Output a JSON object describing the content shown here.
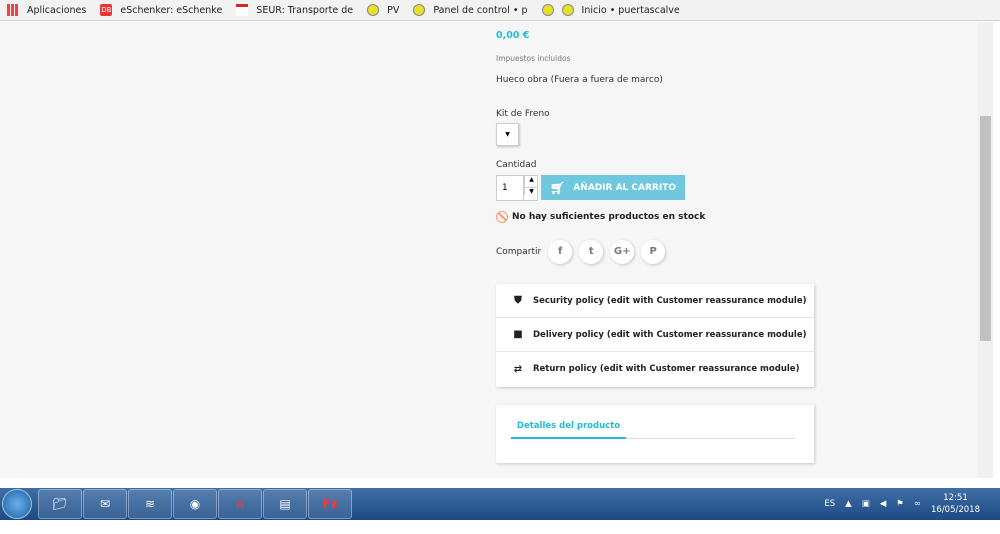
{
  "bookmarks": [
    {
      "label": "Aplicaciones",
      "icon": "apps-grid-icon"
    },
    {
      "label": "eSchenker: eSchenke",
      "icon": "db-icon"
    },
    {
      "label": "SEUR: Transporte de",
      "icon": "seur-icon"
    },
    {
      "label": "PV",
      "icon": "site-icon"
    },
    {
      "label": "Panel de control • p",
      "icon": "site-icon"
    },
    {
      "label": "",
      "icon": "site-icon"
    },
    {
      "label": "Inicio • puertascalve",
      "icon": "site-icon"
    }
  ],
  "product": {
    "price": "0,00 €",
    "tax_label": "Impuestos incluidos",
    "dimension": "Hueco obra (Fuera a fuera de marco)",
    "kit_label": "Kit de Freno",
    "qty_label": "Cantidad",
    "qty_value": "1",
    "add_to_cart": "AÑADIR AL CARRITO",
    "stock_msg": "No hay suficientes productos en stock",
    "share_label": "Compartir",
    "share": [
      "f",
      "t",
      "G+",
      "P"
    ]
  },
  "reassurance": [
    {
      "label": "Security policy (edit with Customer reassurance module)",
      "icon": "shield-icon"
    },
    {
      "label": "Delivery policy (edit with Customer reassurance module)",
      "icon": "truck-icon"
    },
    {
      "label": "Return policy (edit with Customer reassurance module)",
      "icon": "swap-arrows-icon"
    }
  ],
  "details_tab": "Detalles del producto",
  "taskbar": {
    "lang": "ES",
    "time": "12:51",
    "date": "16/05/2018",
    "apps": [
      "explorer",
      "outlook",
      "app",
      "chrome",
      "acrobat",
      "winrar",
      "filezilla"
    ]
  },
  "colors": {
    "accent": "#24b9d7",
    "cart": "#6fc8dd"
  }
}
